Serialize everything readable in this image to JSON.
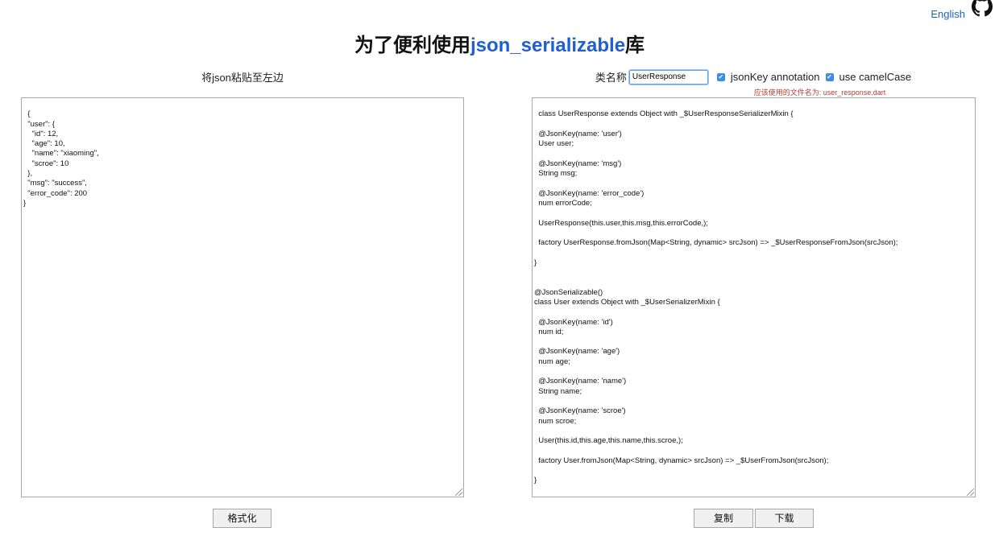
{
  "header": {
    "language_link": "English",
    "title_prefix": "为了便利使用",
    "title_highlight": "json_serializable",
    "title_suffix": "库"
  },
  "left_panel": {
    "label": "将json粘贴至左边",
    "json_text": "{\n  \"user\": {\n    \"id\": 12,\n    \"age\": 10,\n    \"name\": \"xiaoming\",\n    \"scroe\": 10\n  },\n  \"msg\": \"success\",\n  \"error_code\": 200\n}",
    "format_button": "格式化"
  },
  "right_panel": {
    "class_name_label": "类名称",
    "class_name_value": "UserResponse",
    "jsonkey_label": "jsonKey annotation",
    "camelcase_label": "use camelCase",
    "filename_hint": "应该使用的文件名为: user_response.dart",
    "code_text": "class UserResponse extends Object with _$UserResponseSerializerMixin {\n\n  @JsonKey(name: 'user')\n  User user;\n\n  @JsonKey(name: 'msg')\n  String msg;\n\n  @JsonKey(name: 'error_code')\n  num errorCode;\n\n  UserResponse(this.user,this.msg,this.errorCode,);\n\n  factory UserResponse.fromJson(Map<String, dynamic> srcJson) => _$UserResponseFromJson(srcJson);\n\n}\n\n\n@JsonSerializable()\nclass User extends Object with _$UserSerializerMixin {\n\n  @JsonKey(name: 'id')\n  num id;\n\n  @JsonKey(name: 'age')\n  num age;\n\n  @JsonKey(name: 'name')\n  String name;\n\n  @JsonKey(name: 'scroe')\n  num scroe;\n\n  User(this.id,this.age,this.name,this.scroe,);\n\n  factory User.fromJson(Map<String, dynamic> srcJson) => _$UserFromJson(srcJson);\n\n}",
    "copy_button": "复制",
    "download_button": "下载"
  },
  "icons": {
    "github": "github-icon",
    "checkbox": "checkbox-checked-icon"
  },
  "colors": {
    "accent": "#1f5fd1",
    "link": "#1a62c9",
    "hint": "#c0392b",
    "checkbox": "#3b8ee8"
  }
}
